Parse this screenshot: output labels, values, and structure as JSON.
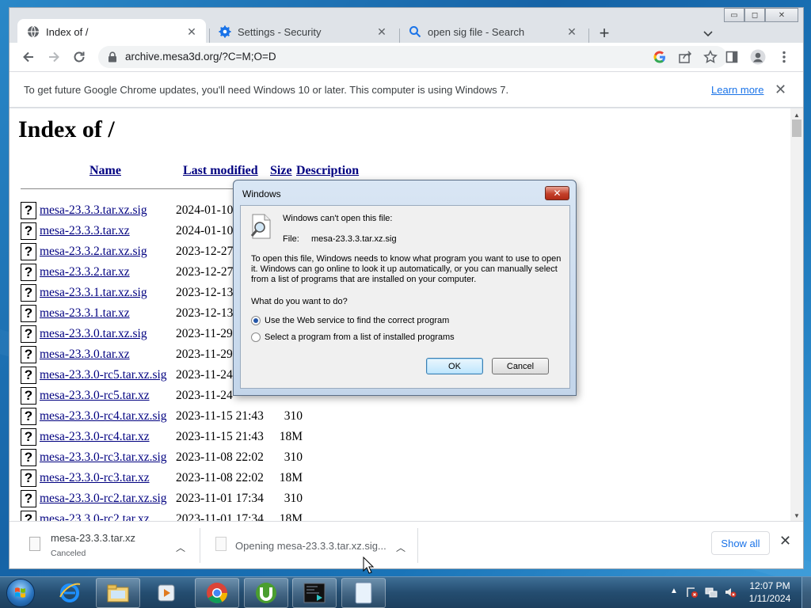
{
  "window": {
    "controls": {
      "minimize": "▭",
      "maximize": "◻",
      "close": "✕"
    }
  },
  "tabs": [
    {
      "title": "Index of /",
      "icon": "globe-icon",
      "active": true
    },
    {
      "title": "Settings - Security",
      "icon": "gear-icon",
      "active": false
    },
    {
      "title": "open sig file - Search",
      "icon": "search-icon",
      "active": false
    }
  ],
  "toolbar": {
    "url_host": "archive.mesa3d.org",
    "url_path": "/?C=M;O=D"
  },
  "infobar": {
    "message": "To get future Google Chrome updates, you'll need Windows 10 or later. This computer is using Windows 7.",
    "link": "Learn more",
    "close": "✕"
  },
  "page": {
    "title": "Index of /",
    "columns": {
      "name": "Name",
      "modified": "Last modified",
      "size": "Size",
      "description": "Description"
    },
    "rows": [
      {
        "name": "mesa-23.3.3.tar.xz.sig",
        "date": "2024-01-10",
        "size": ""
      },
      {
        "name": "mesa-23.3.3.tar.xz",
        "date": "2024-01-10",
        "size": ""
      },
      {
        "name": "mesa-23.3.2.tar.xz.sig",
        "date": "2023-12-27",
        "size": ""
      },
      {
        "name": "mesa-23.3.2.tar.xz",
        "date": "2023-12-27",
        "size": ""
      },
      {
        "name": "mesa-23.3.1.tar.xz.sig",
        "date": "2023-12-13",
        "size": ""
      },
      {
        "name": "mesa-23.3.1.tar.xz",
        "date": "2023-12-13",
        "size": ""
      },
      {
        "name": "mesa-23.3.0.tar.xz.sig",
        "date": "2023-11-29",
        "size": ""
      },
      {
        "name": "mesa-23.3.0.tar.xz",
        "date": "2023-11-29",
        "size": ""
      },
      {
        "name": "mesa-23.3.0-rc5.tar.xz.sig",
        "date": "2023-11-24",
        "size": ""
      },
      {
        "name": "mesa-23.3.0-rc5.tar.xz",
        "date": "2023-11-24",
        "size": ""
      },
      {
        "name": "mesa-23.3.0-rc4.tar.xz.sig",
        "date": "2023-11-15 21:43",
        "size": "310"
      },
      {
        "name": "mesa-23.3.0-rc4.tar.xz",
        "date": "2023-11-15 21:43",
        "size": "18M"
      },
      {
        "name": "mesa-23.3.0-rc3.tar.xz.sig",
        "date": "2023-11-08 22:02",
        "size": "310"
      },
      {
        "name": "mesa-23.3.0-rc3.tar.xz",
        "date": "2023-11-08 22:02",
        "size": "18M"
      },
      {
        "name": "mesa-23.3.0-rc2.tar.xz.sig",
        "date": "2023-11-01 17:34",
        "size": "310"
      },
      {
        "name": "mesa-23.3.0-rc2.tar.xz",
        "date": "2023-11-01 17:34",
        "size": "18M"
      }
    ]
  },
  "downloads": [
    {
      "name": "mesa-23.3.3.tar.xz",
      "status": "Canceled"
    },
    {
      "name": "Opening mesa-23.3.3.tar.xz.sig...",
      "status": ""
    }
  ],
  "shelf": {
    "show_all": "Show all",
    "close": "✕"
  },
  "dialog": {
    "title": "Windows",
    "close": "✕",
    "heading": "Windows can't open this file:",
    "file_label": "File:",
    "file_value": "mesa-23.3.3.tar.xz.sig",
    "paragraph": "To open this file, Windows needs to know what program you want to use to open it. Windows can go online to look it up automatically, or you can manually select from a list of programs that are installed on your computer.",
    "question": "What do you want to do?",
    "options": [
      {
        "label": "Use the Web service to find the correct program",
        "selected": true
      },
      {
        "label": "Select a program from a list of installed programs",
        "selected": false
      }
    ],
    "ok": "OK",
    "cancel": "Cancel"
  },
  "taskbar": {
    "apps": [
      "ie-icon",
      "explorer-icon",
      "media-player-icon",
      "chrome-icon",
      "utorrent-icon",
      "terminal-icon",
      "notepad-icon"
    ],
    "clock_time": "12:07 PM",
    "clock_date": "1/11/2024"
  },
  "colors": {
    "link": "#000080",
    "accent": "#1a73e8",
    "dialog_close": "#c4402a"
  }
}
